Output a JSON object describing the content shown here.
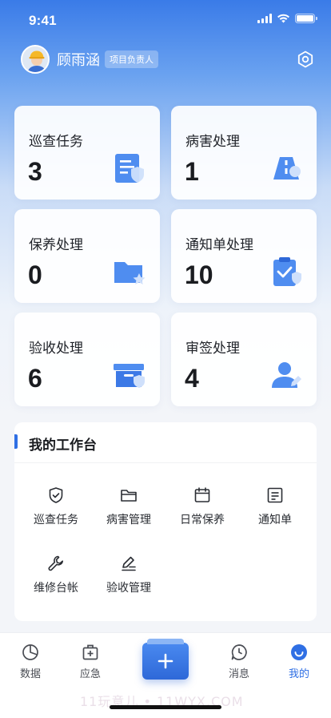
{
  "status_bar": {
    "time": "9:41"
  },
  "profile": {
    "name": "顾雨涵",
    "role": "项目负责人"
  },
  "cards": [
    {
      "label": "巡查任务",
      "count": "3",
      "icon": "document-shield-icon"
    },
    {
      "label": "病害处理",
      "count": "1",
      "icon": "road-icon"
    },
    {
      "label": "保养处理",
      "count": "0",
      "icon": "folder-star-icon"
    },
    {
      "label": "通知单处理",
      "count": "10",
      "icon": "clipboard-check-icon"
    },
    {
      "label": "验收处理",
      "count": "6",
      "icon": "box-shield-icon"
    },
    {
      "label": "审签处理",
      "count": "4",
      "icon": "user-edit-icon"
    }
  ],
  "workbench": {
    "title": "我的工作台",
    "items": [
      {
        "label": "巡查任务",
        "icon": "shield-check-icon"
      },
      {
        "label": "病害管理",
        "icon": "folder-icon"
      },
      {
        "label": "日常保养",
        "icon": "calendar-icon"
      },
      {
        "label": "通知单",
        "icon": "notice-icon"
      },
      {
        "label": "维修台帐",
        "icon": "wrench-icon"
      },
      {
        "label": "验收管理",
        "icon": "edit-icon"
      }
    ]
  },
  "tabbar": {
    "items": [
      {
        "label": "数据",
        "icon": "pie-chart-icon"
      },
      {
        "label": "应急",
        "icon": "first-aid-icon"
      },
      {
        "label": "消息",
        "icon": "message-icon"
      },
      {
        "label": "我的",
        "icon": "smile-icon"
      }
    ],
    "active": "我的"
  },
  "watermark": "11玩意儿 • 11WYX.COM",
  "colors": {
    "primary": "#2f6fe4",
    "hero_top": "#3a7be8",
    "text": "#1d1f24"
  }
}
